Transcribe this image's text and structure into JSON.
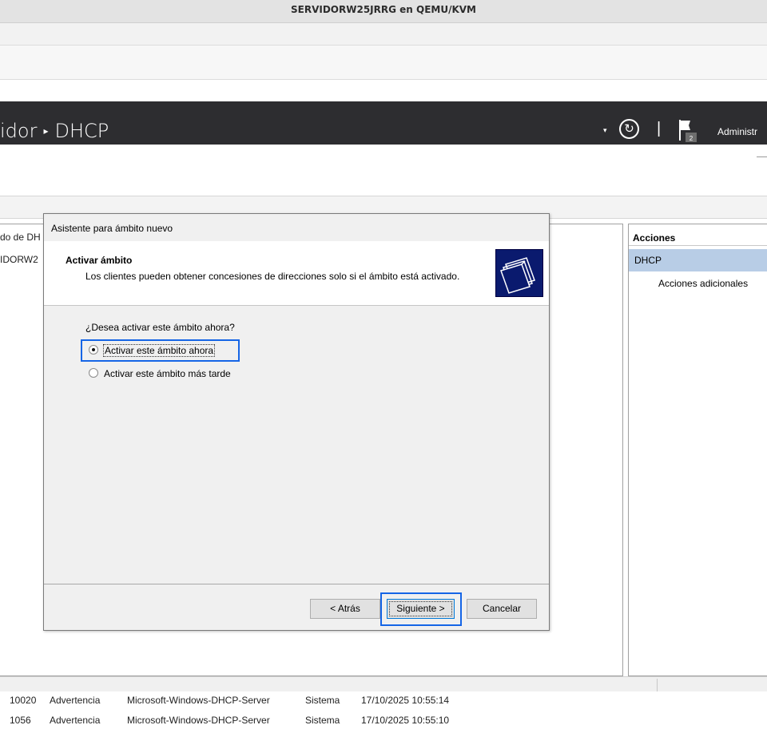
{
  "vm": {
    "title": "SERVIDORW25JRRG en QEMU/KVM"
  },
  "server_manager": {
    "breadcrumb_parent": "idor",
    "breadcrumb_separator": "▸",
    "breadcrumb_current": "DHCP",
    "dropdown_icon": "▾",
    "refresh_icon": "↻",
    "separator": "|",
    "notifications_count": "2",
    "manage_label": "Administr"
  },
  "tree": {
    "item1": "do de DH",
    "item2": "IDORW2"
  },
  "actions": {
    "header": "Acciones",
    "section": "DHCP",
    "more_actions": "Acciones adicionales"
  },
  "events": [
    {
      "id": "10020",
      "level": "Advertencia",
      "source": "Microsoft-Windows-DHCP-Server",
      "log": "Sistema",
      "date": "17/10/2025 10:55:14"
    },
    {
      "id": "1056",
      "level": "Advertencia",
      "source": "Microsoft-Windows-DHCP-Server",
      "log": "Sistema",
      "date": "17/10/2025 10:55:10"
    }
  ],
  "wizard": {
    "title": "Asistente para ámbito nuevo",
    "heading": "Activar ámbito",
    "description": "Los clientes pueden obtener concesiones de direcciones solo si el ámbito está activado.",
    "question": "¿Desea activar este ámbito ahora?",
    "option_now": "Activar este ámbito ahora",
    "option_later": "Activar este ámbito más tarde",
    "selected_option": "option_now",
    "back_label": "< Atrás",
    "next_label": "Siguiente >",
    "cancel_label": "Cancelar"
  },
  "colors": {
    "header_bg": "#2d2d30",
    "focus_highlight": "#1565e6",
    "selection_bg": "#b8cde6",
    "wizard_logo_bg": "#0a1a6e"
  }
}
